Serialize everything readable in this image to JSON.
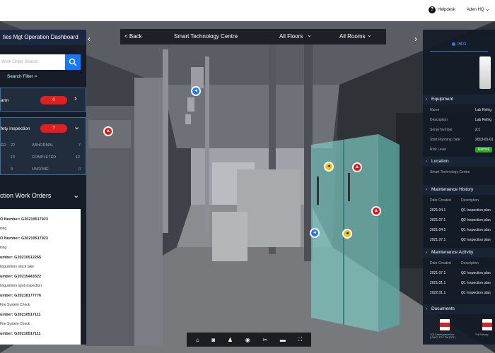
{
  "header": {
    "helpdesk": "Helpdesk",
    "user": "Aden HQ"
  },
  "left": {
    "title": "ties Mgt Operation Dashboard",
    "search_placeholder": "Work Order Search",
    "search_filter": "Search Filter >",
    "alarm": {
      "label": "arm",
      "count": "0"
    },
    "safety": {
      "label": "fety inspection",
      "count": "?"
    },
    "stats": [
      {
        "k": "ED",
        "v": "22",
        "k2": "ABNORMAL",
        "v2": "7"
      },
      {
        "k": "",
        "v": "13",
        "k2": "COMPLETED",
        "v2": "12"
      },
      {
        "k": "",
        "v": "3",
        "k2": "UNDONE",
        "v2": "0"
      }
    ],
    "wo_title": "ction Work Orders",
    "work_orders": [
      {
        "num": "O Number: G20210517923",
        "desc": "iting"
      },
      {
        "num": "O Number: G20210517923",
        "desc": "iting"
      },
      {
        "num": "umber: G20210512265",
        "desc": "tinguishers stock take"
      },
      {
        "num": "umber: G20215443322",
        "desc": "tinguishers spot inspection"
      },
      {
        "num": "umber: G20218177776",
        "desc": "Fire System Check"
      },
      {
        "num": "umber: G20210517111",
        "desc": "Fire System Check"
      },
      {
        "num": "umber: G20210517111",
        "desc": ""
      }
    ]
  },
  "nav": {
    "back": "< Back",
    "site": "Smart Technology Centre",
    "floors": "All Floors",
    "rooms": "All Rooms"
  },
  "right": {
    "tab": "INFO",
    "equipment_title": "Equipment",
    "equipment": [
      {
        "k": "Name",
        "v": "Lab Refrig"
      },
      {
        "k": "Description",
        "v": "Lab Refrig"
      },
      {
        "k": "Serial Number",
        "v": "2.1"
      },
      {
        "k": "Start Running Date",
        "v": "2013-01-01"
      }
    ],
    "risk_label": "Risk Level",
    "risk_value": "Normal",
    "location_title": "Location",
    "location_value": "Smart Technology Centre",
    "mh_title": "Maintenance History",
    "mh_headers": [
      "Date Created",
      "Description"
    ],
    "mh_rows": [
      {
        "d": "2021.04.1",
        "t": "Q1 Inspection plan"
      },
      {
        "d": "2021.07.1",
        "t": "Q2 Inspection plan"
      },
      {
        "d": "2021.04.1",
        "t": "Q1 Inspection plan"
      },
      {
        "d": "2021.07.1",
        "t": "Q2 Inspection plan"
      }
    ],
    "ma_title": "Maintenance Activity",
    "ma_headers": [
      "Date Created",
      "Description"
    ],
    "ma_rows": [
      {
        "d": "2021.07.1",
        "t": "Q2 Inspection plan"
      },
      {
        "d": "2021.01.1",
        "t": "Q1 Inspection plan"
      },
      {
        "d": "2022.01.1",
        "t": "Q1 Inspection plan"
      }
    ],
    "docs_title": "Documents",
    "docs": [
      {
        "name": "1Q1 Assetsgasolution (HVAC) PPC PM (BTF)"
      },
      {
        "name": "Tok Sabung"
      }
    ]
  },
  "toolbar": [
    {
      "name": "home-icon",
      "glyph": "⌂"
    },
    {
      "name": "camera-icon",
      "glyph": "◙"
    },
    {
      "name": "person-icon",
      "glyph": "♟"
    },
    {
      "name": "eye-icon",
      "glyph": "◉"
    },
    {
      "name": "scissors-icon",
      "glyph": "✂"
    },
    {
      "name": "ruler-icon",
      "glyph": "▬"
    },
    {
      "name": "fullscreen-icon",
      "glyph": "⛶"
    }
  ],
  "colors": {
    "accent": "#1677ff",
    "alarm": "#e02020",
    "normal": "#2aa52a",
    "panel": "#121a26"
  }
}
